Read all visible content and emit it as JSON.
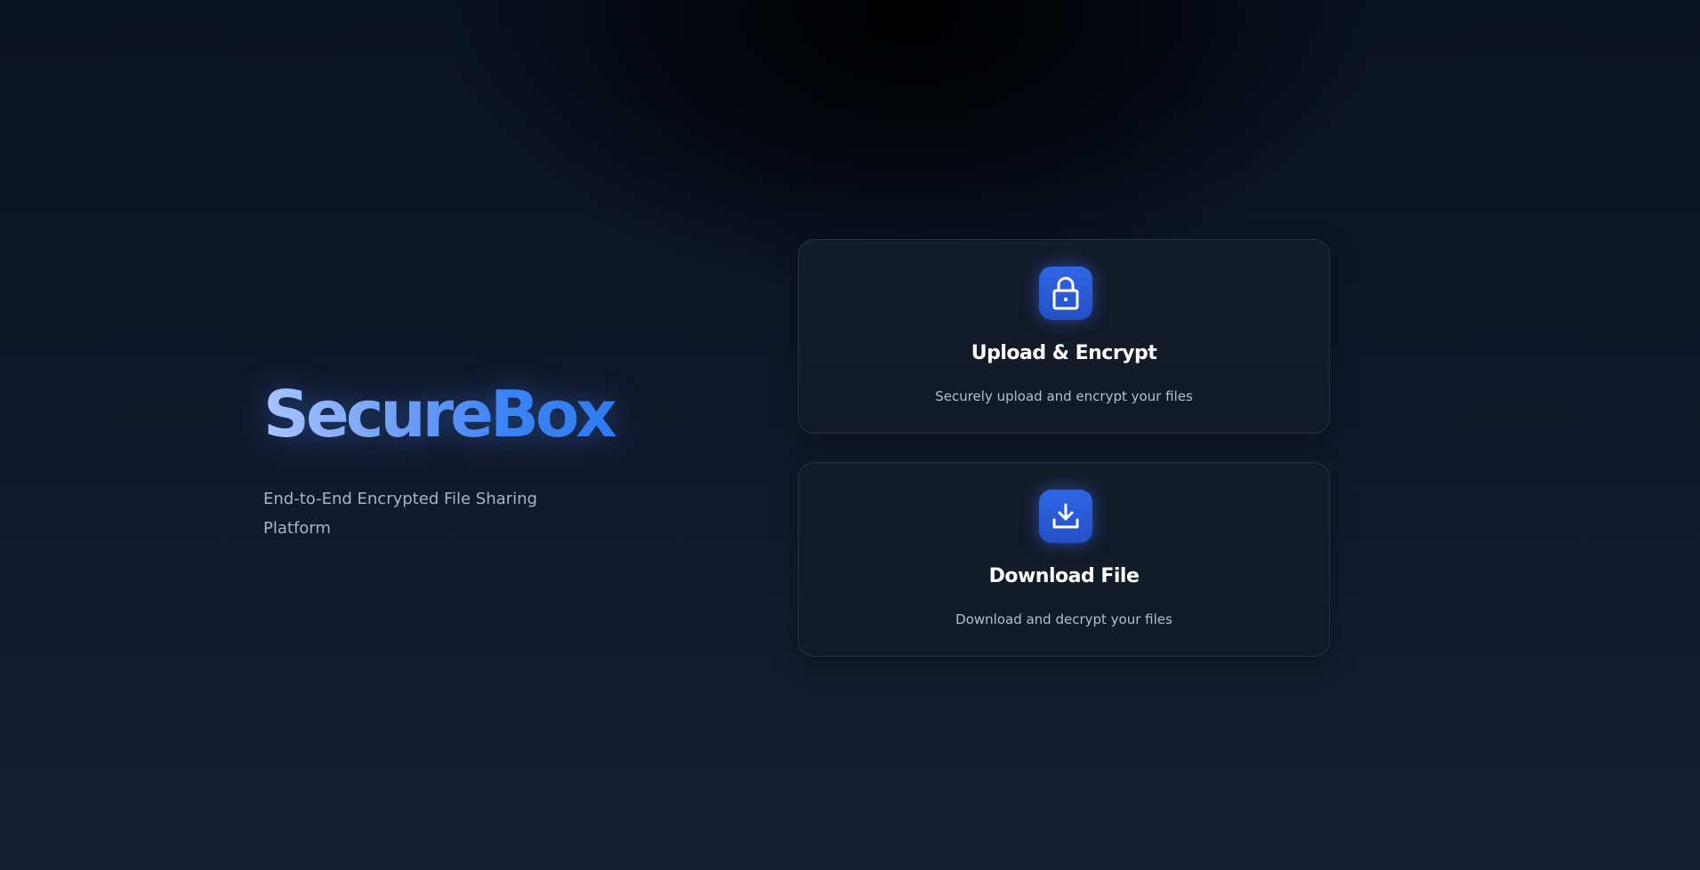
{
  "brand": {
    "name": "SecureBox",
    "tagline": "End-to-End Encrypted File Sharing Platform"
  },
  "actions": [
    {
      "title": "Upload & Encrypt",
      "description": "Securely upload and encrypt your files",
      "icon": "lock-icon"
    },
    {
      "title": "Download File",
      "description": "Download and decrypt your files",
      "icon": "download-icon"
    }
  ],
  "colors": {
    "accent": "#3b82f6",
    "logo_gradient_start": "#a8c4ff",
    "logo_gradient_end": "#2f7bf0",
    "icon_tile": "#2d5fe0",
    "card_background": "#131b29",
    "card_border": "#263143",
    "page_background": "#0f172a"
  }
}
